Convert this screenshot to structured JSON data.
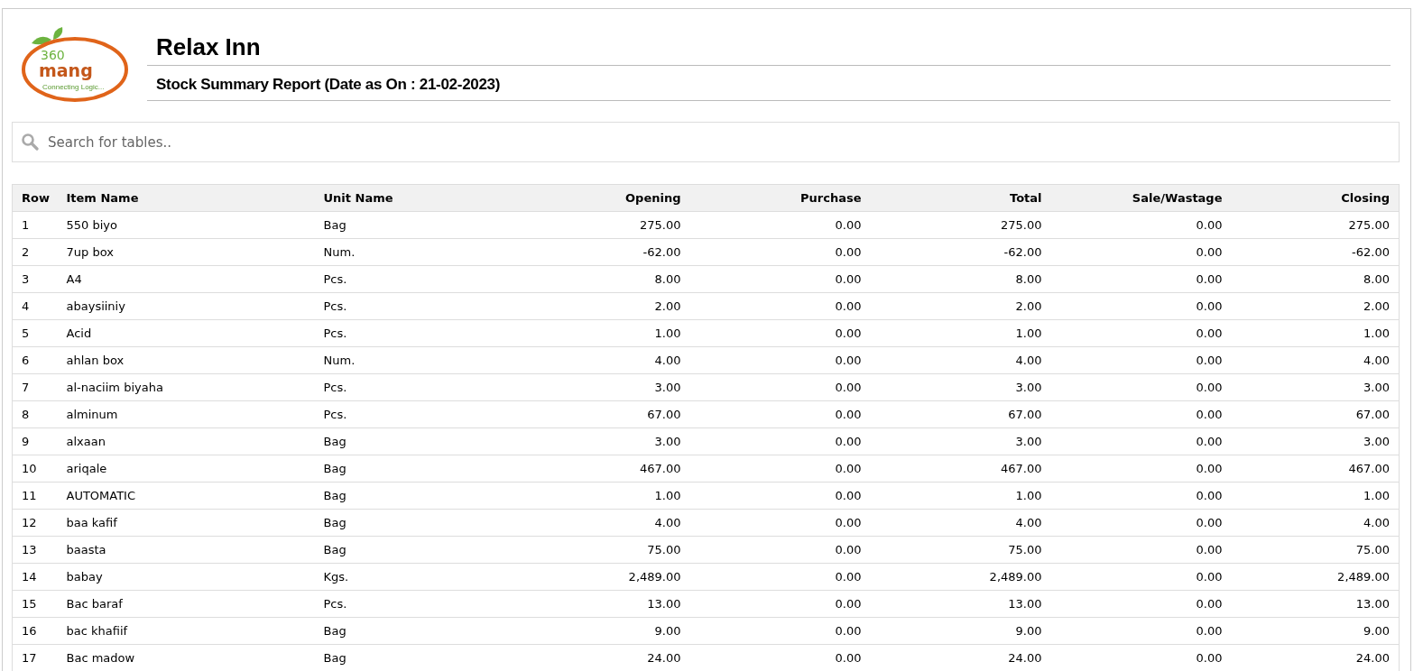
{
  "logo": {
    "number": "360",
    "word": "mang",
    "tagline": "Connecting Logic..."
  },
  "header": {
    "title": "Relax Inn",
    "subtitle": "Stock Summary Report (Date as On : 21-02-2023)"
  },
  "search": {
    "placeholder": "Search for tables.."
  },
  "table": {
    "columns": [
      "Row",
      "Item Name",
      "Unit Name",
      "Opening",
      "Purchase",
      "Total",
      "Sale/Wastage",
      "Closing"
    ],
    "rows": [
      [
        "1",
        "550 biyo",
        "Bag",
        "275.00",
        "0.00",
        "275.00",
        "0.00",
        "275.00"
      ],
      [
        "2",
        "7up box",
        "Num.",
        "-62.00",
        "0.00",
        "-62.00",
        "0.00",
        "-62.00"
      ],
      [
        "3",
        "A4",
        "Pcs.",
        "8.00",
        "0.00",
        "8.00",
        "0.00",
        "8.00"
      ],
      [
        "4",
        "abaysiiniy",
        "Pcs.",
        "2.00",
        "0.00",
        "2.00",
        "0.00",
        "2.00"
      ],
      [
        "5",
        "Acid",
        "Pcs.",
        "1.00",
        "0.00",
        "1.00",
        "0.00",
        "1.00"
      ],
      [
        "6",
        "ahlan box",
        "Num.",
        "4.00",
        "0.00",
        "4.00",
        "0.00",
        "4.00"
      ],
      [
        "7",
        "al-naciim biyaha",
        "Pcs.",
        "3.00",
        "0.00",
        "3.00",
        "0.00",
        "3.00"
      ],
      [
        "8",
        "alminum",
        "Pcs.",
        "67.00",
        "0.00",
        "67.00",
        "0.00",
        "67.00"
      ],
      [
        "9",
        "alxaan",
        "Bag",
        "3.00",
        "0.00",
        "3.00",
        "0.00",
        "3.00"
      ],
      [
        "10",
        "ariqale",
        "Bag",
        "467.00",
        "0.00",
        "467.00",
        "0.00",
        "467.00"
      ],
      [
        "11",
        "AUTOMATIC",
        "Bag",
        "1.00",
        "0.00",
        "1.00",
        "0.00",
        "1.00"
      ],
      [
        "12",
        "baa kafif",
        "Bag",
        "4.00",
        "0.00",
        "4.00",
        "0.00",
        "4.00"
      ],
      [
        "13",
        "baasta",
        "Bag",
        "75.00",
        "0.00",
        "75.00",
        "0.00",
        "75.00"
      ],
      [
        "14",
        "babay",
        "Kgs.",
        "2,489.00",
        "0.00",
        "2,489.00",
        "0.00",
        "2,489.00"
      ],
      [
        "15",
        "Bac baraf",
        "Pcs.",
        "13.00",
        "0.00",
        "13.00",
        "0.00",
        "13.00"
      ],
      [
        "16",
        "bac khafiif",
        "Bag",
        "9.00",
        "0.00",
        "9.00",
        "0.00",
        "9.00"
      ],
      [
        "17",
        "Bac madow",
        "Bag",
        "24.00",
        "0.00",
        "24.00",
        "0.00",
        "24.00"
      ]
    ]
  }
}
